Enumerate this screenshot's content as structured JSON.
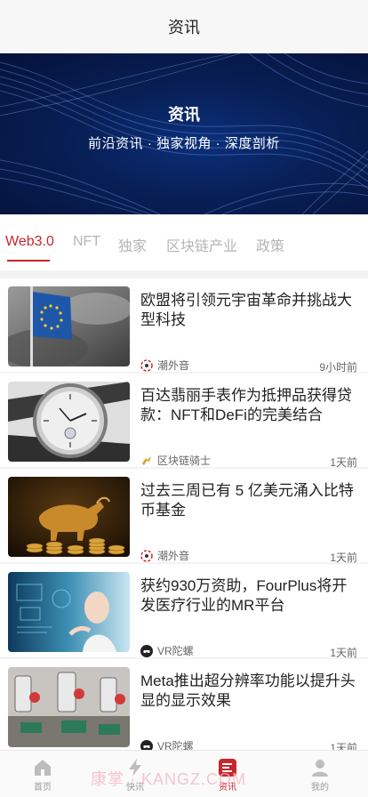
{
  "header": {
    "title": "资讯"
  },
  "banner": {
    "title": "资讯",
    "subtitle": "前沿资讯 · 独家视角 · 深度剖析"
  },
  "tabs": [
    "Web3.0",
    "NFT",
    "独家",
    "区块链产业",
    "政策"
  ],
  "articles": [
    {
      "title": "欧盟将引领元宇宙革命并挑战大型科技",
      "source": "潮外音",
      "source_icon": "chaowaiyin-logo-icon",
      "time": "9小时前",
      "image": "eu-flag-image"
    },
    {
      "title": "百达翡丽手表作为抵押品获得贷款：NFT和DeFi的完美结合",
      "source": "区块链骑士",
      "source_icon": "knight-logo-icon",
      "time": "1天前",
      "image": "watch-image"
    },
    {
      "title": "过去三周已有 5 亿美元涌入比特币基金",
      "source": "潮外音",
      "source_icon": "chaowaiyin-logo-icon",
      "time": "1天前",
      "image": "bull-coins-image"
    },
    {
      "title": "获约930万资助，FourPlus将开发医疗行业的MR平台",
      "source": "VR陀螺",
      "source_icon": "vr-tuoluo-logo-icon",
      "time": "1天前",
      "image": "mr-medical-image"
    },
    {
      "title": "Meta推出超分辨率功能以提升头显的显示效果",
      "source": "VR陀螺",
      "source_icon": "vr-tuoluo-logo-icon",
      "time": "1天前",
      "image": "robot-arms-image"
    }
  ],
  "tabbar": [
    {
      "label": "首页",
      "icon": "home-icon"
    },
    {
      "label": "快讯",
      "icon": "flash-icon"
    },
    {
      "label": "资讯",
      "icon": "news-icon",
      "active": true
    },
    {
      "label": "我的",
      "icon": "profile-icon"
    }
  ],
  "watermark": "康掌 · KANGZ.COM",
  "colors": {
    "accent": "#c8262c",
    "banner": "#0a2566",
    "muted": "#999999"
  }
}
